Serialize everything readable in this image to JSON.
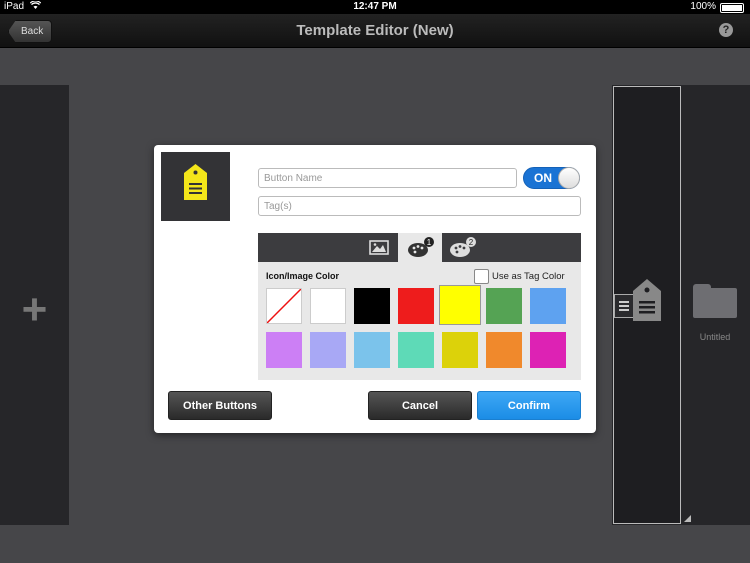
{
  "status_bar": {
    "carrier": "iPad",
    "time": "12:47 PM",
    "battery": "100%"
  },
  "nav": {
    "back_label": "Back",
    "title": "Template Editor (New)",
    "help": "?"
  },
  "left_panel": {
    "add_symbol": "+"
  },
  "right_panel": {
    "folder_label": "Untitled"
  },
  "dialog": {
    "preview_icon_color": "#f4e61a",
    "button_name_placeholder": "Button Name",
    "tags_placeholder": "Tag(s)",
    "toggle_label": "ON",
    "tabs": [
      {
        "icon": "image-icon"
      },
      {
        "icon": "palette-1-icon",
        "badge": "1"
      },
      {
        "icon": "palette-2-icon",
        "badge": "2"
      }
    ],
    "color_title": "Icon/Image Color",
    "use_tag_label": "Use as Tag Color",
    "selected_color": "#ffff00",
    "colors": [
      "none",
      "#ffffff",
      "#000000",
      "#ee1c1c",
      "#ffff00",
      "#55a354",
      "#5ea2f0",
      "#cc7ff5",
      "#a8a8f5",
      "#7bc3eb",
      "#5edab7",
      "#dcd20a",
      "#f0892c",
      "#dd22b4"
    ],
    "other_buttons": "Other Buttons",
    "cancel": "Cancel",
    "confirm": "Confirm"
  }
}
